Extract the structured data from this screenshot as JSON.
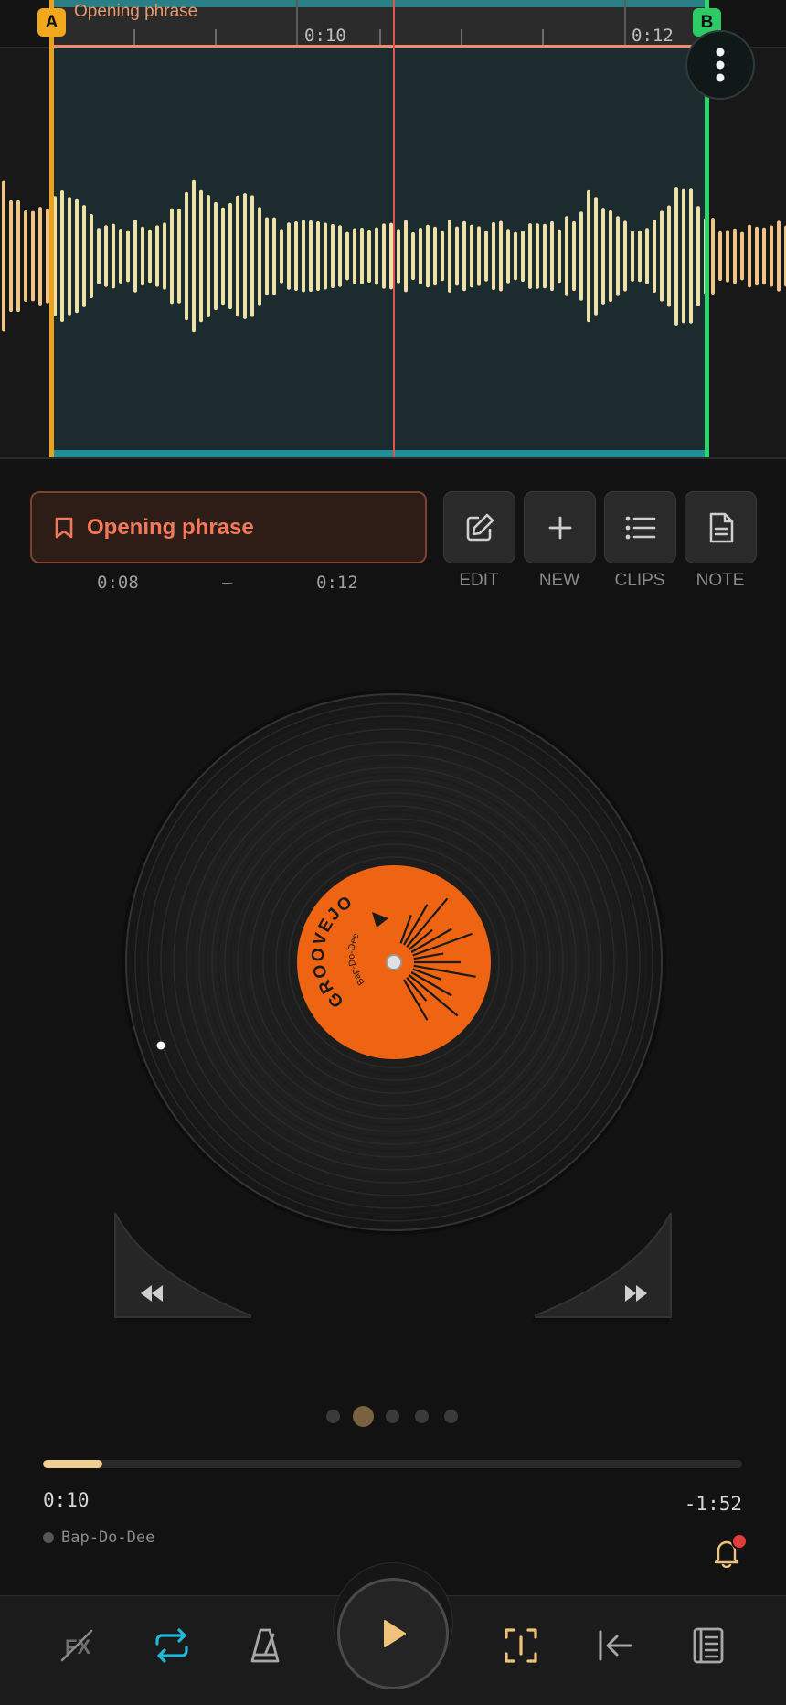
{
  "waveform": {
    "region_name": "Opening phrase",
    "marker_a": "A",
    "marker_b": "B",
    "tick_labels": [
      "0:10",
      "0:12"
    ]
  },
  "clip": {
    "name": "Opening phrase",
    "start": "0:08",
    "separator": "–",
    "end": "0:12"
  },
  "tools": {
    "edit": "EDIT",
    "new": "NEW",
    "clips": "CLIPS",
    "note": "NOTE"
  },
  "record": {
    "brand": "GROOVEJOG",
    "track": "Bap-Do-Dee"
  },
  "pager": {
    "count": 5,
    "active_index": 1
  },
  "playback": {
    "elapsed": "0:10",
    "remaining": "-1:52",
    "progress_fraction": 0.085,
    "track_name": "Bap-Do-Dee"
  },
  "colors": {
    "accent_orange": "#f2795a",
    "marker_a": "#f2a81e",
    "marker_b": "#2ccb66",
    "loop_active": "#22b8d8",
    "label_orange": "#ef6412"
  },
  "icons": {
    "more": "more-vertical-icon",
    "bookmark": "bookmark-icon",
    "edit": "pencil-icon",
    "new": "plus-icon",
    "clips": "list-icon",
    "note": "document-icon",
    "fx": "fx-off-icon",
    "loop": "repeat-icon",
    "metronome": "metronome-icon",
    "play": "play-icon",
    "select": "cursor-select-icon",
    "to_start": "skip-to-start-icon",
    "notes": "notebook-icon",
    "bell": "bell-icon"
  }
}
